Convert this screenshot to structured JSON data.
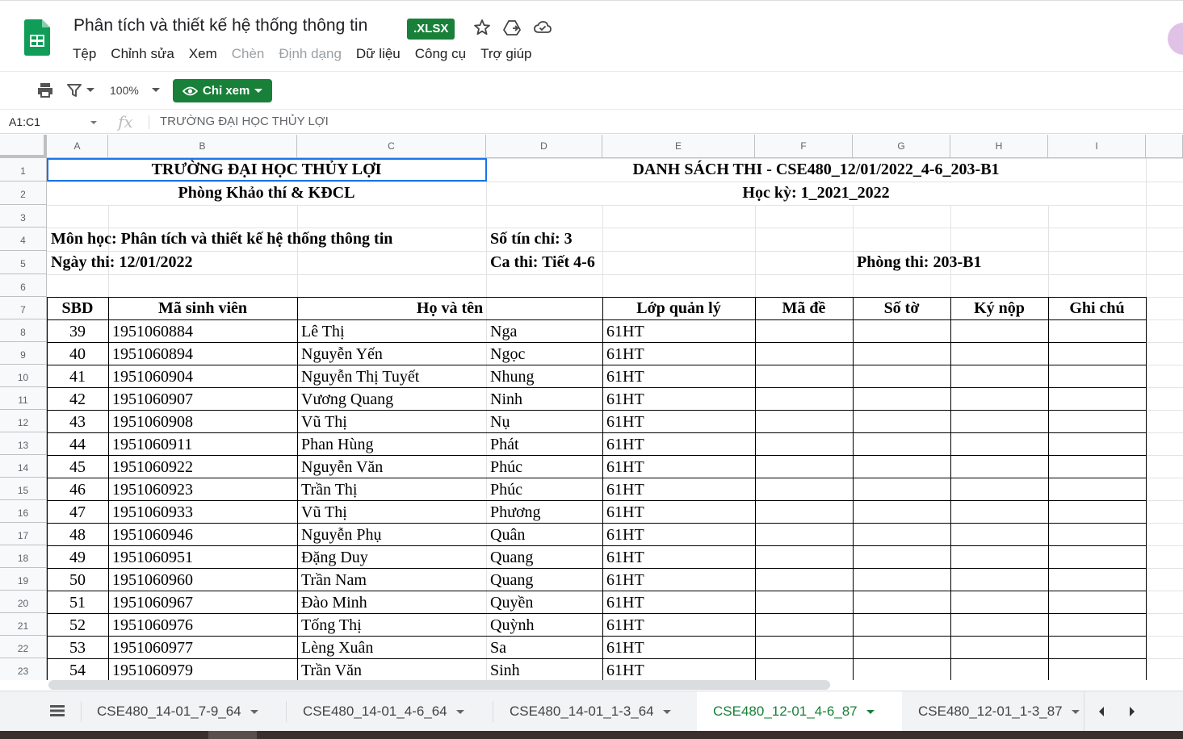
{
  "header": {
    "doc_title": "Phân tích và thiết kế hệ thống thông tin",
    "file_badge": ".XLSX",
    "menu": [
      "Tệp",
      "Chỉnh sửa",
      "Xem",
      "Chèn",
      "Định dạng",
      "Dữ liệu",
      "Công cụ",
      "Trợ giúp"
    ]
  },
  "toolbar": {
    "zoom": "100%",
    "view_only_label": "Chỉ xem"
  },
  "formula_bar": {
    "name_box": "A1:C1",
    "fx": "fx",
    "content": "TRƯỜNG ĐẠI HỌC THỦY LỢI"
  },
  "columns": [
    "A",
    "B",
    "C",
    "D",
    "E",
    "F",
    "G",
    "H",
    "I"
  ],
  "rows": [
    "1",
    "2",
    "3",
    "4",
    "5",
    "6",
    "7",
    "8",
    "9",
    "10",
    "11",
    "12",
    "13",
    "14",
    "15",
    "16",
    "17",
    "18",
    "19",
    "20",
    "21",
    "22",
    "23"
  ],
  "sheet": {
    "school": "TRƯỜNG ĐẠI HỌC THỦY LỢI",
    "office": "Phòng Khảo thí & KĐCL",
    "list_title": "DANH SÁCH THI - CSE480_12/01/2022_4-6_203-B1",
    "semester": "Học kỳ: 1_2021_2022",
    "subject": "Môn học: Phân tích và thiết kế hệ thống thông tin",
    "credits": "Số tín chỉ: 3",
    "exam_date": "Ngày thi: 12/01/2022",
    "shift": "Ca thi: Tiết 4-6",
    "room": "Phòng thi: 203-B1",
    "table_headers": {
      "sbd": "SBD",
      "student_id": "Mã sinh viên",
      "full_name": "Họ và tên",
      "class": "Lớp quản lý",
      "exam_code": "Mã đề",
      "sheets": "Số tờ",
      "signature": "Ký nộp",
      "note": "Ghi chú"
    },
    "students": [
      [
        "39",
        "1951060884",
        "Lê Thị",
        "Nga",
        "61HT"
      ],
      [
        "40",
        "1951060894",
        "Nguyễn Yến",
        "Ngọc",
        "61HT"
      ],
      [
        "41",
        "1951060904",
        "Nguyễn Thị Tuyết",
        "Nhung",
        "61HT"
      ],
      [
        "42",
        "1951060907",
        "Vương Quang",
        "Ninh",
        "61HT"
      ],
      [
        "43",
        "1951060908",
        "Vũ Thị",
        "Nụ",
        "61HT"
      ],
      [
        "44",
        "1951060911",
        "Phan Hùng",
        "Phát",
        "61HT"
      ],
      [
        "45",
        "1951060922",
        "Nguyễn Văn",
        "Phúc",
        "61HT"
      ],
      [
        "46",
        "1951060923",
        "Trần Thị",
        "Phúc",
        "61HT"
      ],
      [
        "47",
        "1951060933",
        "Vũ Thị",
        "Phương",
        "61HT"
      ],
      [
        "48",
        "1951060946",
        "Nguyễn Phụ",
        "Quân",
        "61HT"
      ],
      [
        "49",
        "1951060951",
        "Đặng Duy",
        "Quang",
        "61HT"
      ],
      [
        "50",
        "1951060960",
        "Trần Nam",
        "Quang",
        "61HT"
      ],
      [
        "51",
        "1951060967",
        "Đào Minh",
        "Quyền",
        "61HT"
      ],
      [
        "52",
        "1951060976",
        "Tống Thị",
        "Quỳnh",
        "61HT"
      ],
      [
        "53",
        "1951060977",
        "Lèng Xuân",
        "Sa",
        "61HT"
      ],
      [
        "54",
        "1951060979",
        "Trần Văn",
        "Sinh",
        "61HT"
      ]
    ]
  },
  "sheet_tabs": [
    {
      "label": "CSE480_14-01_7-9_64",
      "active": false
    },
    {
      "label": "CSE480_14-01_4-6_64",
      "active": false
    },
    {
      "label": "CSE480_14-01_1-3_64",
      "active": false
    },
    {
      "label": "CSE480_12-01_4-6_87",
      "active": true
    },
    {
      "label": "CSE480_12-01_1-3_87",
      "active": false
    }
  ],
  "colors": {
    "brand_green": "#188038",
    "selection_blue": "#1a73e8"
  },
  "icons": [
    "sheets-logo-icon",
    "star-icon",
    "move-to-drive-icon",
    "cloud-status-icon",
    "print-icon",
    "filter-icon",
    "view-only-eye-icon",
    "all-sheets-icon",
    "scroll-left-icon",
    "scroll-right-icon"
  ]
}
